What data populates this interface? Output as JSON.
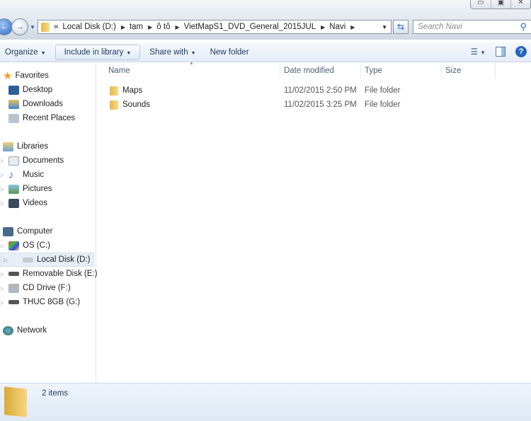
{
  "window": {
    "buttons": [
      "minimize",
      "restore",
      "close"
    ]
  },
  "address": {
    "overflow": "«",
    "crumbs": [
      "Local Disk (D:)",
      "tạm",
      "ô tô",
      "VietMapS1_DVD_General_2015JUL",
      "Navi"
    ],
    "search_placeholder": "Search Navi"
  },
  "toolbar": {
    "organize": "Organize",
    "include": "Include in library",
    "share": "Share with",
    "new_folder": "New folder"
  },
  "sidebar": {
    "favorites": "Favorites",
    "desktop": "Desktop",
    "downloads": "Downloads",
    "recent": "Recent Places",
    "libraries": "Libraries",
    "documents": "Documents",
    "music": "Music",
    "pictures": "Pictures",
    "videos": "Videos",
    "computer": "Computer",
    "os": "OS (C:)",
    "local": "Local Disk (D:)",
    "removable": "Removable Disk (E:)",
    "cd": "CD Drive (F:)",
    "thuc": "THUC 8GB (G:)",
    "network": "Network"
  },
  "columns": {
    "name": "Name",
    "date": "Date modified",
    "type": "Type",
    "size": "Size"
  },
  "files": [
    {
      "name": "Maps",
      "date": "11/02/2015 2:50 PM",
      "type": "File folder",
      "size": ""
    },
    {
      "name": "Sounds",
      "date": "11/02/2015 3:25 PM",
      "type": "File folder",
      "size": ""
    }
  ],
  "status": {
    "count": "2 items"
  }
}
